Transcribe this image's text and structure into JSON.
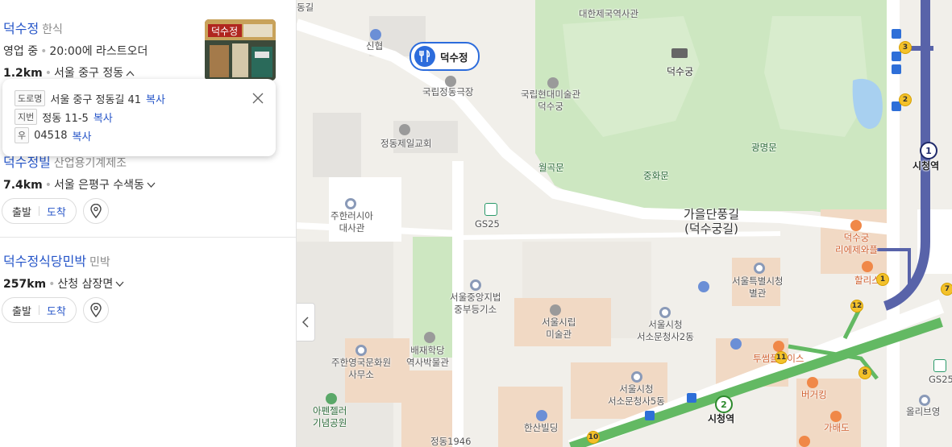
{
  "results": [
    {
      "name": "덕수정",
      "category": "한식",
      "status": "영업 중",
      "hours": "20:00에 라스트오더",
      "distance": "1.2km",
      "region": "서울 중구 정동"
    },
    {
      "name": "덕수정빌",
      "category": "산업용기계제조",
      "distance": "7.4km",
      "region": "서울 은평구 수색동",
      "start_label": "출발",
      "arrive_label": "도착"
    },
    {
      "name": "덕수정식당민박",
      "category": "민박",
      "distance": "257km",
      "region": "산청 삼장면",
      "start_label": "출발",
      "arrive_label": "도착"
    }
  ],
  "address_popup": {
    "road_tag": "도로명",
    "road_address": "서울 중구 정동길 41",
    "lot_tag": "지번",
    "lot_address": "정동 11-5",
    "zip_tag": "우",
    "zip_code": "04518",
    "copy_label": "복사"
  },
  "map": {
    "marker_label": "덕수정",
    "labels": {
      "top_road": "동길",
      "shinhyup": "신협",
      "theater": "국립정동극장",
      "korean_empire_hall": "대한제국역사관",
      "deoksugung": "덕수궁",
      "mmca": "국립현대미술관\n덕수궁",
      "church": "정동제일교회",
      "wolgeunmun": "월곡문",
      "junghwamun": "중화문",
      "gwangmyeongmun": "광명문",
      "gs25": "GS25",
      "russia_embassy": "주한러시아\n대사관",
      "road_main": "가을단풍길\n(덕수궁길)",
      "cafe_bar": "덕수궁\n리에제와플",
      "hollys": "할리스",
      "seoul_annex": "서울특별시청\n별관",
      "court": "서울중앙지법\n중부등기소",
      "art_museum": "서울시립\n미술관",
      "seosomun2": "서울시청\n서소문청사2동",
      "paichai": "배재학당\n역사박물관",
      "uk_office": "주한영국문화원\n사무소",
      "appenzeller": "아펜젤러\n기념공원",
      "seosomun5": "서울시청\n서소문청사5동",
      "hanshin": "한산빌딩",
      "jeongdong1946": "정동1946",
      "city_hall_stn": "시청역",
      "city_hall_stn_top": "시청역",
      "twosome": "투썸플레이스",
      "burgerking": "버거킹",
      "gabedo": "가배도",
      "gs25_right": "GS25",
      "olive": "올리브영"
    },
    "exits": [
      "3",
      "2",
      "1",
      "12",
      "11",
      "8",
      "10",
      "7"
    ],
    "line_numbers": {
      "line1": "1",
      "line2": "2"
    },
    "colors": {
      "park": "#cde7c1",
      "line1": "#5863a9",
      "line2": "#63b963",
      "accent": "#2c6cdc",
      "link": "#2454c8"
    }
  }
}
